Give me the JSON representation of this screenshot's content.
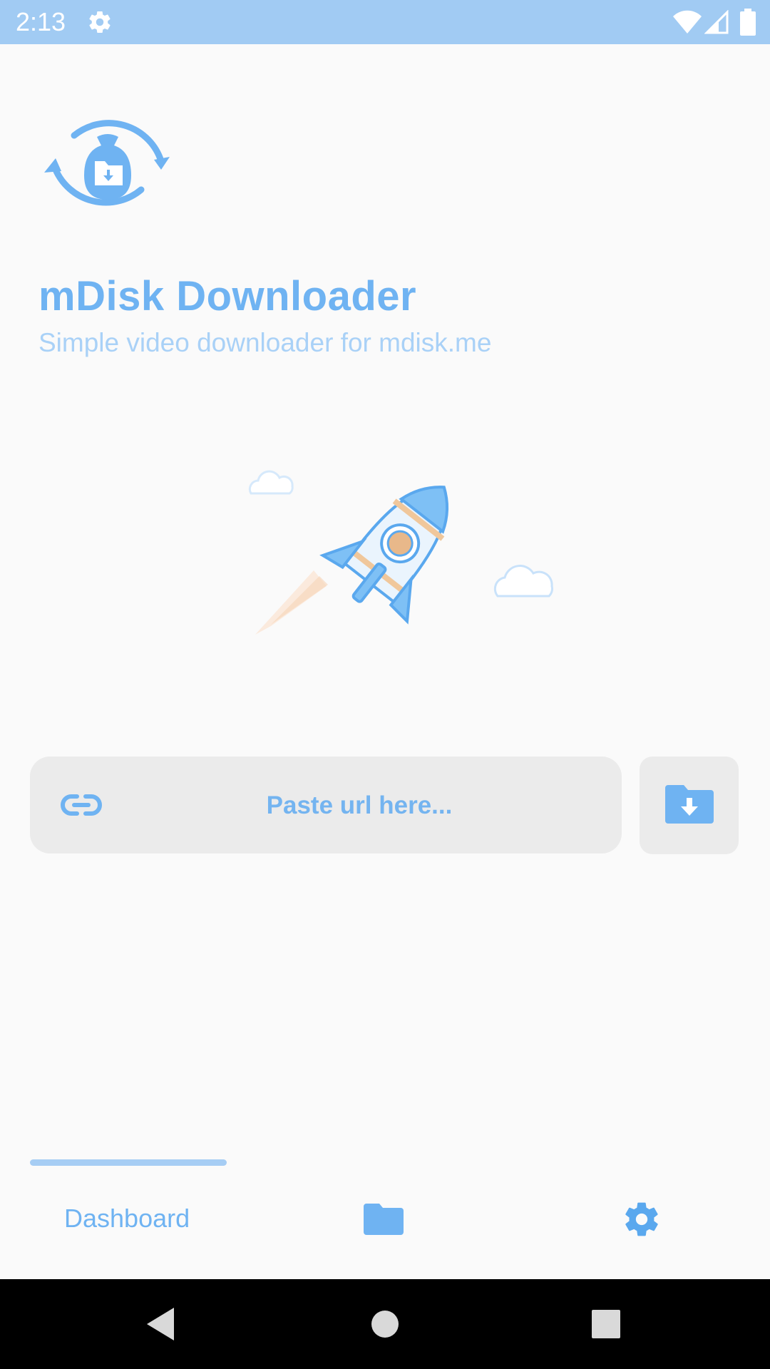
{
  "status_bar": {
    "time": "2:13",
    "left_icons": [
      "gear-icon"
    ],
    "right_icons": [
      "wifi-icon",
      "signal-icon",
      "battery-icon"
    ]
  },
  "app": {
    "logo_icon": "download-bag-sync-icon",
    "title": "mDisk Downloader",
    "subtitle": "Simple video downloader for mdisk.me",
    "illustration": "rocket-illustration"
  },
  "url_input": {
    "value": "",
    "placeholder": "Paste url here...",
    "icon": "link-icon"
  },
  "download_button": {
    "icon": "folder-download-icon"
  },
  "bottom_nav": {
    "items": [
      {
        "label": "Dashboard",
        "active": true
      },
      {
        "icon": "folder-icon"
      },
      {
        "icon": "settings-gear-icon"
      }
    ]
  },
  "android_nav": [
    "back-icon",
    "home-icon",
    "recents-icon"
  ],
  "colors": {
    "accent": "#6fb3f2",
    "accent_light": "#a9d1f7",
    "status_bar": "#a1cbf3",
    "input_bg": "#ebebeb",
    "background": "#fafafa"
  }
}
